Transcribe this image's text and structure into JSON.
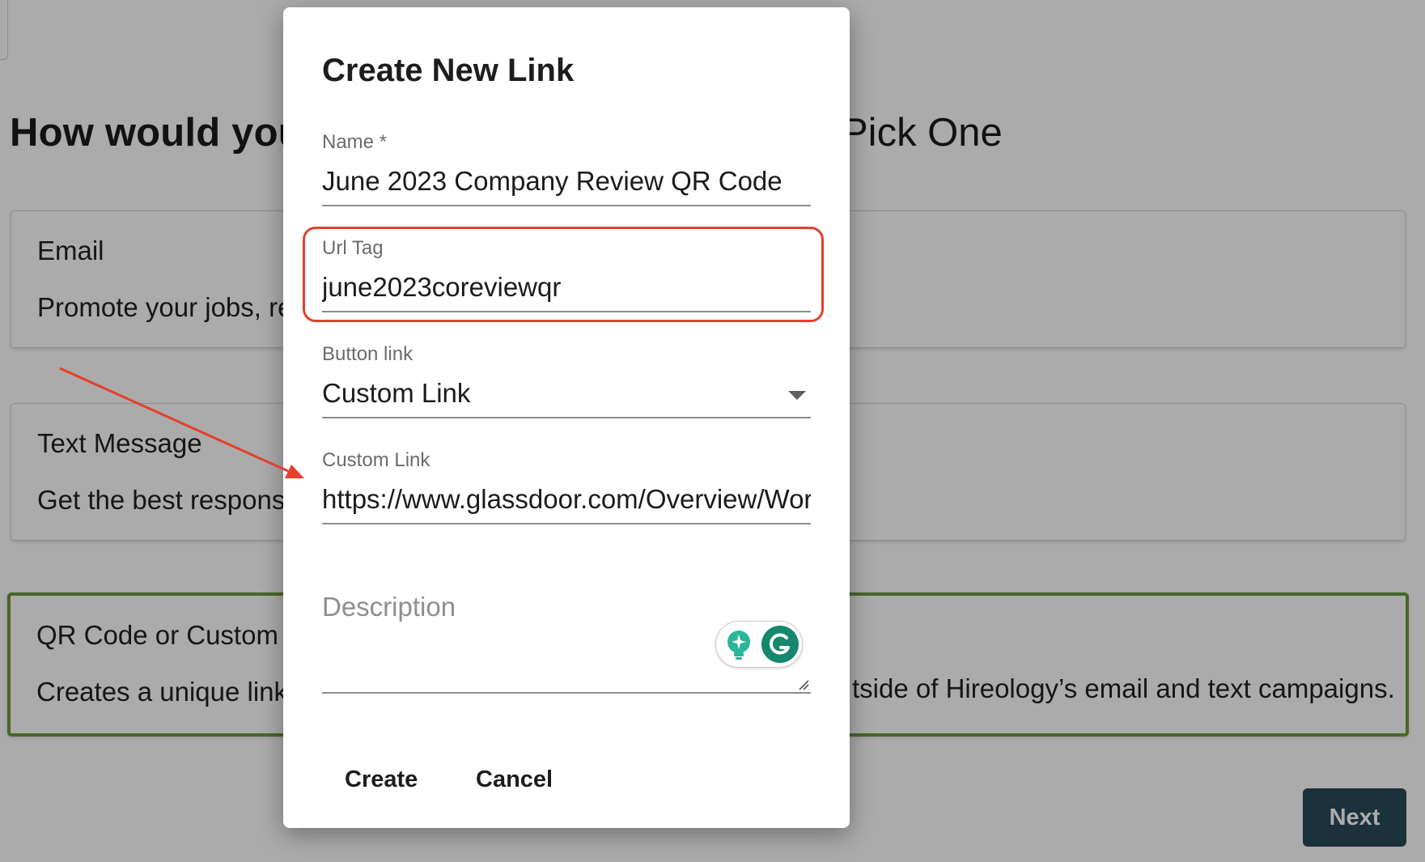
{
  "page": {
    "title_start": "How would you",
    "title_end": "Pick One",
    "cards": [
      {
        "title": "Email",
        "description": "Promote your jobs, re",
        "description_tail": ""
      },
      {
        "title": "Text Message",
        "description": "Get the best response",
        "description_tail": ""
      },
      {
        "title": "QR Code or Custom L",
        "description": "Creates a unique link",
        "description_tail": "tside of Hireology’s email and text campaigns."
      }
    ],
    "next_label": "Next"
  },
  "dialog": {
    "title": "Create New Link",
    "name": {
      "label": "Name *",
      "value": "June 2023 Company Review QR Code"
    },
    "url_tag": {
      "label": "Url Tag",
      "value": "june2023coreviewqr"
    },
    "button_link": {
      "label": "Button link",
      "value": "Custom Link"
    },
    "custom_link": {
      "label": "Custom Link",
      "value": "https://www.glassdoor.com/Overview/Wor"
    },
    "description": {
      "placeholder": "Description"
    },
    "create_label": "Create",
    "cancel_label": "Cancel"
  },
  "colors": {
    "accent_selected": "#6b9a3a",
    "next_button": "#294a5a",
    "annotation": "#e4402c",
    "grammarly": "#15876c"
  },
  "icons": [
    "dropdown-caret-icon",
    "lightbulb-icon",
    "grammarly-icon",
    "resize-grip-icon",
    "annotation-arrow"
  ]
}
